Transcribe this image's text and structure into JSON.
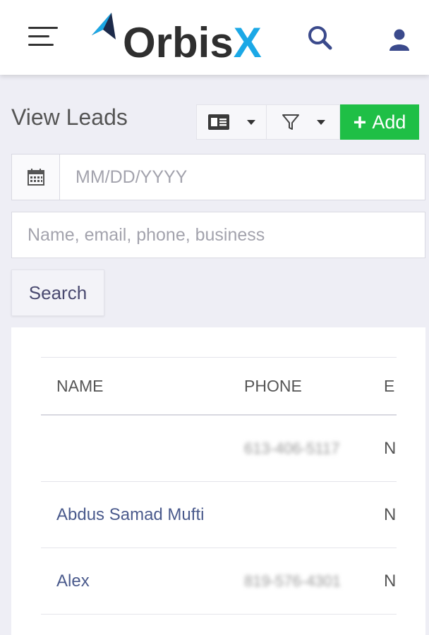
{
  "header": {
    "menu_icon": "hamburger-menu-icon",
    "logo": {
      "text_main": "Orbis",
      "text_accent": "X",
      "accent_color": "#1ba8e6",
      "text_color": "#2f2f2f"
    },
    "search_icon": "search-icon",
    "user_icon": "user-icon",
    "icon_color": "#3b4a8c"
  },
  "page": {
    "title": "View Leads"
  },
  "toolbar": {
    "view_icon": "contact-card-icon",
    "filter_icon": "filter-icon",
    "add_label": "Add",
    "add_color": "#1fbf46"
  },
  "filters": {
    "date_placeholder": "MM/DD/YYYY",
    "query_placeholder": "Name, email, phone, business",
    "search_label": "Search"
  },
  "table": {
    "columns": [
      "NAME",
      "PHONE",
      "E"
    ],
    "rows": [
      {
        "name": "",
        "phone": "613-406-5117",
        "email": "N"
      },
      {
        "name": "Abdus Samad Mufti",
        "phone": "",
        "email": "N"
      },
      {
        "name": "Alex",
        "phone": "819-576-4301",
        "email": "N"
      }
    ]
  }
}
